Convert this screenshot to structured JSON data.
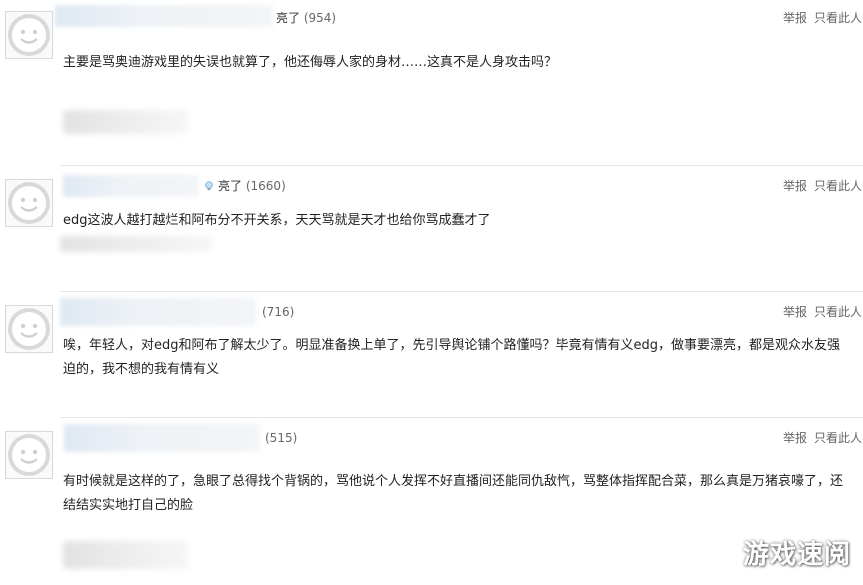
{
  "comments": [
    {
      "title": "亮了",
      "count": "(954)",
      "report": "举报",
      "only_this": "只看此人",
      "text": "主要是骂奥迪游戏里的失误也就算了，他还侮辱人家的身材……这真不是人身攻击吗？"
    },
    {
      "title": "亮了",
      "count": "(1660)",
      "report": "举报",
      "only_this": "只看此人",
      "text": "edg这波人越打越烂和阿布分不开关系，天天骂就是天才也给你骂成蠢才了"
    },
    {
      "title": "",
      "count": "(716)",
      "report": "举报",
      "only_this": "只看此人",
      "text": "唉，年轻人，对edg和阿布了解太少了。明显准备换上单了，先引导舆论铺个路懂吗？毕竟有情有义edg，做事要漂亮，都是观众水友强迫的，我不想的我有情有义"
    },
    {
      "title": "",
      "count": "(515)",
      "report": "举报",
      "only_this": "只看此人",
      "text": "有时候就是这样的了，急眼了总得找个背锅的，骂他说个人发挥不好直播间还能同仇敌忾，骂整体指挥配合菜，那么真是万猪哀嚎了，还结结实实地打自己的脸"
    }
  ],
  "watermark": "游戏速阅"
}
